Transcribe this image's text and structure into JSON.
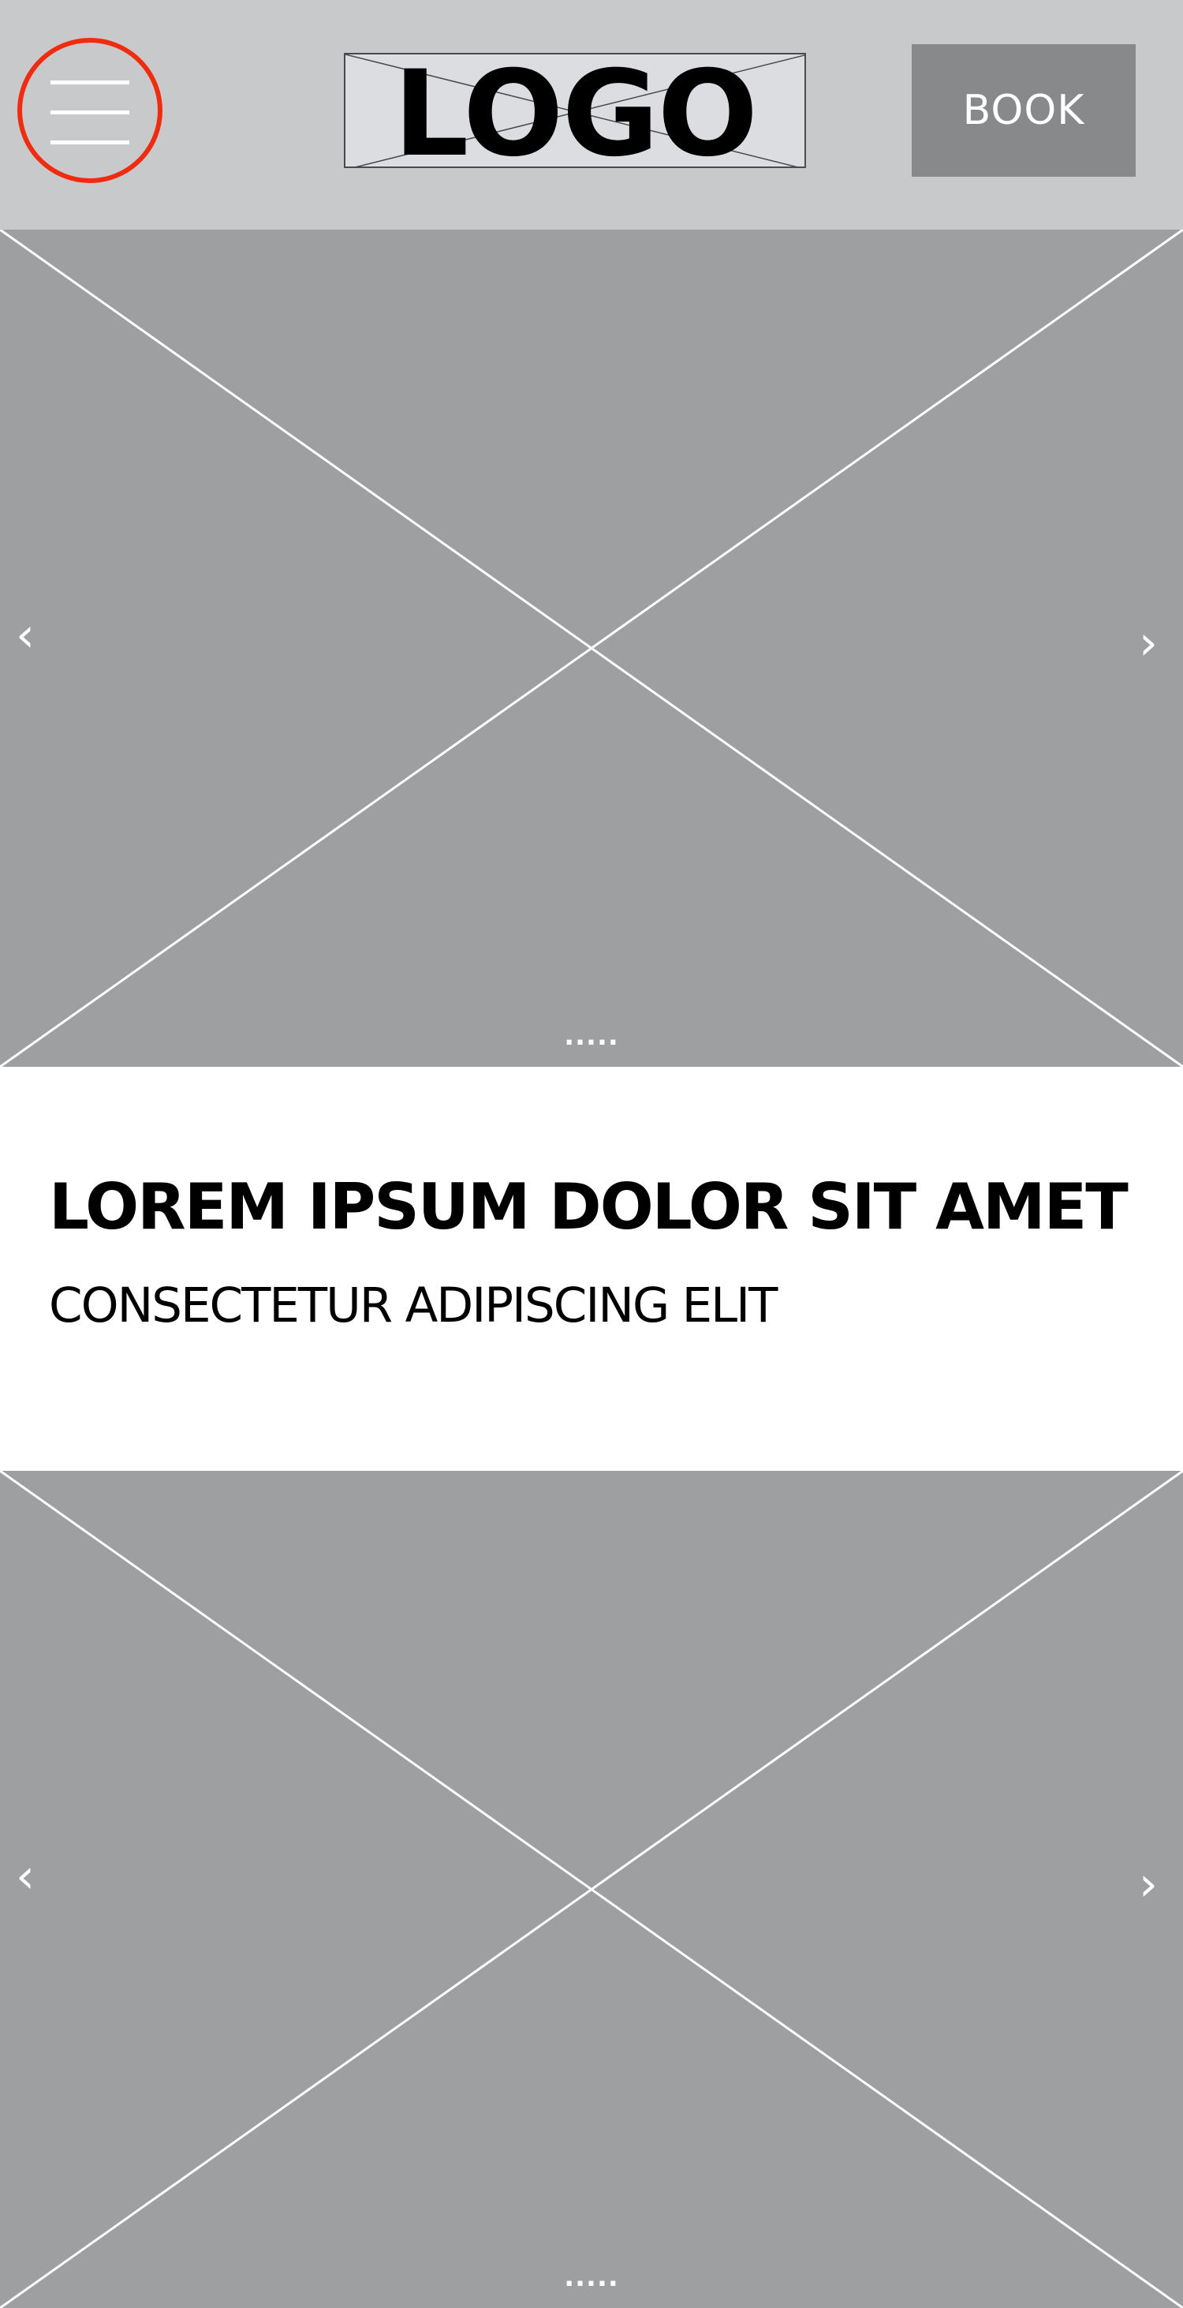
{
  "header": {
    "menu_icon": "hamburger-menu-icon",
    "logo_text": "LOGO",
    "book_label": "BOOK"
  },
  "carousels": [
    {
      "prev_arrow": "‹",
      "next_arrow": "›",
      "dots": "....."
    },
    {
      "prev_arrow": "‹",
      "next_arrow": "›",
      "dots": "....."
    }
  ],
  "content": {
    "headline": "LOREM IPSUM DOLOR SIT AMET",
    "subheadline": "CONSECTETUR ADIPISCING ELIT"
  },
  "colors": {
    "header_bg": "#c8c9cb",
    "menu_ring": "#f02b0f",
    "book_button_bg": "#88898b",
    "placeholder_bg": "#9e9fa1"
  }
}
